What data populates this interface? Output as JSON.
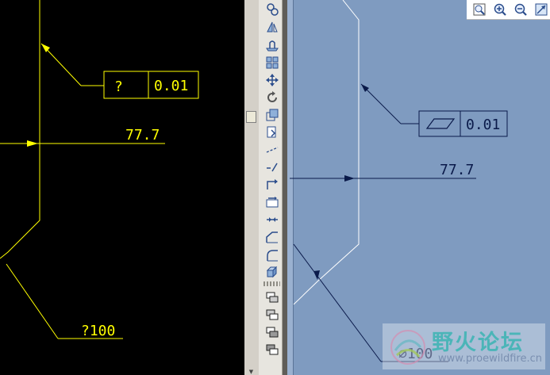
{
  "left_view": {
    "flatness_symbol": "?",
    "tolerance": "0.01",
    "dimension": "77.7",
    "diameter_label": "?100"
  },
  "right_view": {
    "tolerance": "0.01",
    "dimension": "77.7",
    "diameter_label": "∅100"
  },
  "toolbar": {
    "items": [
      "spin-center-icon",
      "mirror-icon",
      "ship-icon",
      "array-icon",
      "move-icon",
      "rotate-icon",
      "scale-icon",
      "copy-icon",
      "line-dim-icon",
      "angled-line-icon",
      "offset-icon",
      "copy-arrow-icon",
      "trim-icon",
      "chamfer-icon",
      "round-icon",
      "3d-box-icon",
      "layer-icon-1",
      "layer-icon-2",
      "layer-icon-3",
      "layer-icon-4"
    ]
  },
  "zoom_tools": [
    "zoom-window-icon",
    "zoom-in-icon",
    "zoom-out-icon",
    "refit-icon"
  ],
  "watermark": {
    "title": "野火论坛",
    "url": "www.proewildfire.cn"
  },
  "colors": {
    "left_bg": "#000000",
    "left_lines": "#ffff00",
    "right_bg": "#7f9bc0",
    "right_lines": "#0a1a4a",
    "part_edge": "#ffffff"
  }
}
